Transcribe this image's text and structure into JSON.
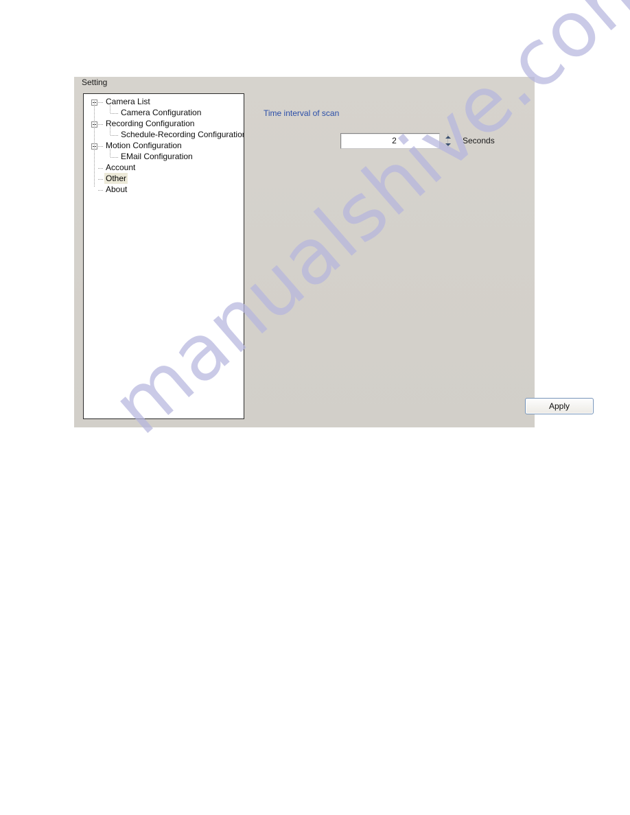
{
  "dialog": {
    "group_label": "Setting"
  },
  "tree": {
    "nodes": [
      {
        "label": "Camera List",
        "level": 0,
        "expandable": true,
        "selected": false
      },
      {
        "label": "Camera Configuration",
        "level": 1,
        "expandable": false,
        "selected": false
      },
      {
        "label": "Recording Configuration",
        "level": 0,
        "expandable": true,
        "selected": false
      },
      {
        "label": "Schedule-Recording Configuration",
        "level": 1,
        "expandable": false,
        "selected": false
      },
      {
        "label": "Motion Configuration",
        "level": 0,
        "expandable": true,
        "selected": false
      },
      {
        "label": "EMail Configuration",
        "level": 1,
        "expandable": false,
        "selected": false
      },
      {
        "label": "Account",
        "level": 0,
        "expandable": false,
        "selected": false
      },
      {
        "label": "Other",
        "level": 0,
        "expandable": false,
        "selected": true
      },
      {
        "label": "About",
        "level": 0,
        "expandable": false,
        "selected": false
      }
    ]
  },
  "content": {
    "interval_label": "Time interval of scan",
    "interval_value": "2",
    "units_label": "Seconds",
    "apply_label": "Apply"
  },
  "watermark": {
    "text": "manualshive.com"
  },
  "colors": {
    "dialog_background": "#d4d0c8",
    "panel_background": "#ffffff",
    "link_text": "#2b4ea8",
    "selection_highlight": "#ece9d8",
    "watermark": "#b6b6de"
  }
}
